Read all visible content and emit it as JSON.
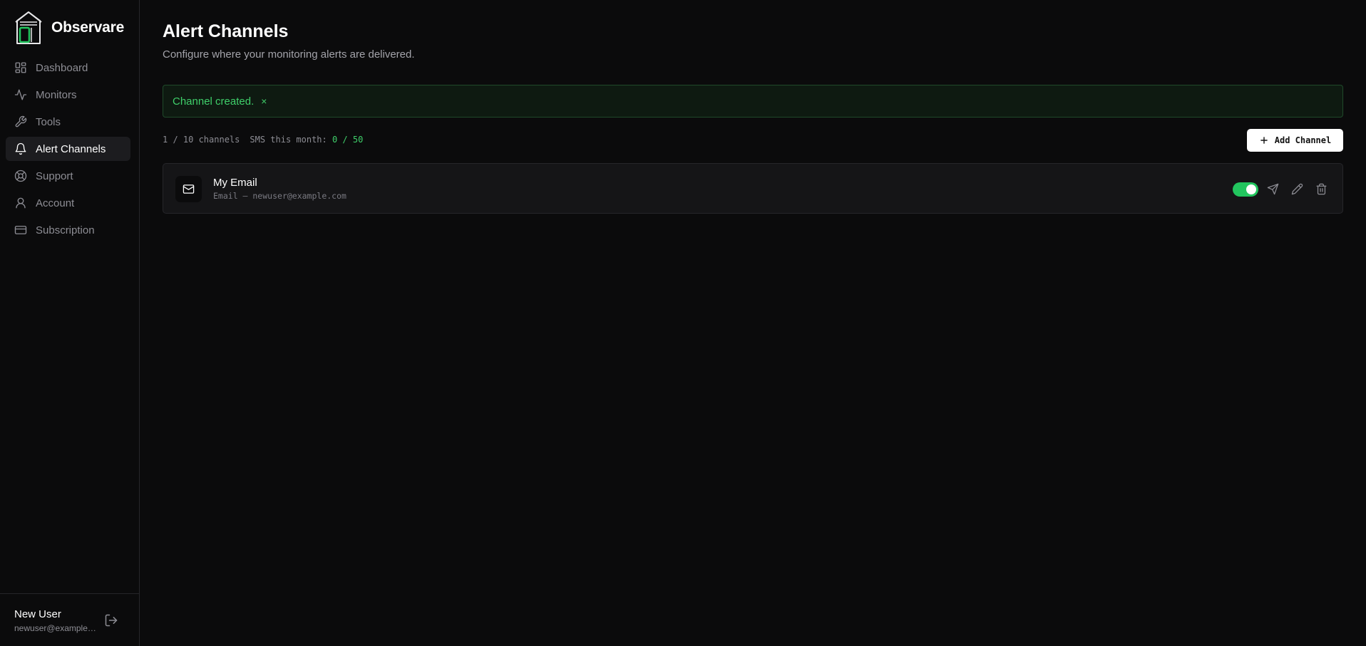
{
  "brand": {
    "name": "Observare",
    "accent": "#22c55e"
  },
  "sidebar": {
    "items": [
      {
        "label": "Dashboard",
        "icon": "dashboard-icon",
        "active": false
      },
      {
        "label": "Monitors",
        "icon": "activity-icon",
        "active": false
      },
      {
        "label": "Tools",
        "icon": "wrench-icon",
        "active": false
      },
      {
        "label": "Alert Channels",
        "icon": "bell-icon",
        "active": true
      },
      {
        "label": "Support",
        "icon": "lifebuoy-icon",
        "active": false
      },
      {
        "label": "Account",
        "icon": "user-icon",
        "active": false
      },
      {
        "label": "Subscription",
        "icon": "credit-card-icon",
        "active": false
      }
    ]
  },
  "user": {
    "name": "New User",
    "email": "newuser@example.com",
    "logout_icon": "logout-icon"
  },
  "page": {
    "title": "Alert Channels",
    "subtitle": "Configure where your monitoring alerts are delivered."
  },
  "alert": {
    "message": "Channel created.",
    "close": "×"
  },
  "stats": {
    "channels": "1 / 10 channels",
    "sms_label": "SMS this month:",
    "sms_value": "0 / 50"
  },
  "actions": {
    "add_channel": "Add Channel"
  },
  "channels": [
    {
      "name": "My Email",
      "detail": "Email — newuser@example.com",
      "type_icon": "mail-icon",
      "enabled": true
    }
  ]
}
